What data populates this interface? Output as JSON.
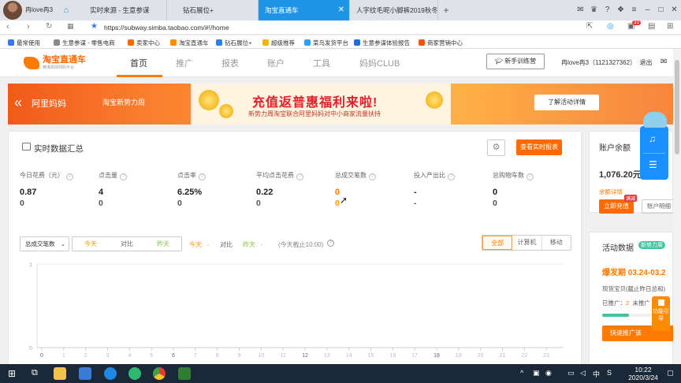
{
  "browser": {
    "profile_name": "冉love冉3",
    "tabs": [
      {
        "label": "实时来源 - 生意参谋",
        "active": false
      },
      {
        "label": "钻石展位+",
        "active": false
      },
      {
        "label": "淘宝直通车",
        "active": true
      },
      {
        "label": "人字纹毛呢小脚裤2019秋冬新",
        "active": false
      }
    ],
    "url": "https://subway.simba.taobao.com/#!/home",
    "notif_count": "33",
    "bookmarks": [
      {
        "label": "最常使用",
        "color": "#3478f6"
      },
      {
        "label": "生意参谋 - 零售电商",
        "color": "#1e6fd9"
      },
      {
        "label": "卖家中心",
        "color": "#ff6a00"
      },
      {
        "label": "淘宝直通车",
        "color": "#ff8c00"
      },
      {
        "label": "钻石展位+",
        "color": "#2a82e4"
      },
      {
        "label": "超级推荐",
        "color": "#f4b400"
      },
      {
        "label": "菜鸟发货平台",
        "color": "#2ea0ff"
      },
      {
        "label": "生意参谋体验报告",
        "color": "#1e6fd9"
      },
      {
        "label": "商家营销中心",
        "color": "#ff5000"
      }
    ]
  },
  "app": {
    "logo_title": "淘宝直通车",
    "logo_sub": "精准高效网购平台",
    "nav": [
      "首页",
      "推广",
      "报表",
      "账户",
      "工具",
      "妈妈CLUB"
    ],
    "guide_button": "新手训练营",
    "user": "冉love冉3（1121327362）",
    "logout": "退出"
  },
  "banner": {
    "ali_logo": "阿里妈妈",
    "tag": "淘宝新势力周",
    "headline": "充值返普惠福利来啦!",
    "subline": "新势力周淘宝联合阿里妈妈对中小商家流量扶持",
    "button": "了解活动详情"
  },
  "realtime": {
    "title": "实时数据汇总",
    "report_button": "查看实时报表",
    "metrics": [
      {
        "label": "今日花费（元）",
        "today": "0.87",
        "yesterday": "0",
        "orange": false
      },
      {
        "label": "点击量",
        "today": "4",
        "yesterday": "0",
        "orange": false
      },
      {
        "label": "点击率",
        "today": "6.25%",
        "yesterday": "0",
        "orange": false
      },
      {
        "label": "平均点击花费",
        "today": "0.22",
        "yesterday": "0",
        "orange": false
      },
      {
        "label": "总成交笔数",
        "today": "0",
        "yesterday": "0",
        "orange": true
      },
      {
        "label": "投入产出比",
        "today": "-",
        "yesterday": "-",
        "orange": false
      },
      {
        "label": "总购物车数",
        "today": "0",
        "yesterday": "0",
        "orange": false
      }
    ],
    "dropdown": "总成交笔数",
    "compare_options": [
      "今天",
      "对比",
      "昨天"
    ],
    "legend": {
      "today": "今天:",
      "today_val": "-",
      "compare": "对比",
      "yesterday": "昨天:",
      "yesterday_val": "-",
      "cutoff": "(今天截止10:00)"
    },
    "device_options": [
      "全部",
      "计算机",
      "移动"
    ],
    "device_selected": 0
  },
  "chart_data": {
    "type": "line",
    "title": "",
    "xlabel": "",
    "ylabel": "",
    "x_ticks": [
      "0",
      "1",
      "2",
      "3",
      "4",
      "5",
      "6",
      "7",
      "8",
      "9",
      "10",
      "11",
      "12",
      "13",
      "14",
      "15",
      "16",
      "17",
      "18",
      "19",
      "20",
      "21",
      "22",
      "23"
    ],
    "x_labeled_ticks": [
      "0",
      "6",
      "12",
      "18"
    ],
    "ylim": [
      0,
      1
    ],
    "y_ticks": [
      "0",
      "1"
    ],
    "series": [],
    "grid": "horizontal"
  },
  "account": {
    "title": "账户余额",
    "balance": "1,076.20元",
    "detail_link": "余额详情",
    "recharge_button": "立即充值",
    "recharge_badge": "满减",
    "account_detail": "账户明细"
  },
  "activity": {
    "title": "活动数据",
    "badge": "新势力周",
    "period": "爆发期 03.24-03.2",
    "line1": "现货宝贝(截止昨日总和)",
    "line2_label": "已推广：",
    "line2_value": "2",
    "line2_suffix": "未推广",
    "button": "快速推广该"
  },
  "float_guide": "功能引导",
  "taskbar": {
    "time": "10:22",
    "date": "2020/3/24",
    "ime": "中",
    "lang": "S"
  }
}
